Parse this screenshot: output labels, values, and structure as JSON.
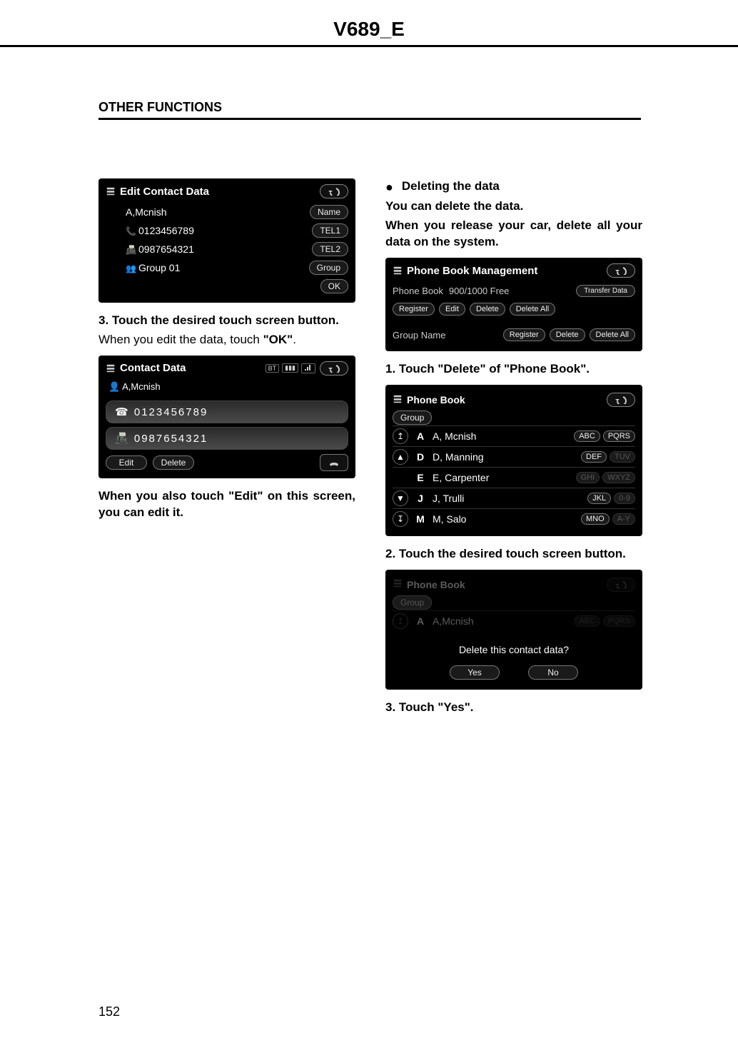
{
  "header": {
    "title": "V689_E"
  },
  "section": {
    "title": "OTHER FUNCTIONS"
  },
  "page_number": "152",
  "left": {
    "screen1": {
      "title": "Edit Contact Data",
      "rows": [
        {
          "icon": "",
          "text": "A,Mcnish",
          "btn": "Name"
        },
        {
          "icon": "📞",
          "text": "0123456789",
          "btn": "TEL1"
        },
        {
          "icon": "📠",
          "text": "0987654321",
          "btn": "TEL2"
        },
        {
          "icon": "👥",
          "text": "Group 01",
          "btn": "Group"
        }
      ],
      "ok": "OK"
    },
    "step3": "3.  Touch the desired touch screen button.",
    "step3_sub_pre": "When you edit the data, touch ",
    "step3_sub_ok": "\"OK\"",
    "step3_sub_post": ".",
    "screen2": {
      "title": "Contact Data",
      "ind_bt": "BT",
      "ind_batt": "▮▮▮",
      "person": "A,Mcnish",
      "rows": [
        {
          "icon": "☎",
          "text": "0123456789"
        },
        {
          "icon": "📠",
          "text": "0987654321"
        }
      ],
      "edit": "Edit",
      "delete": "Delete"
    },
    "note": "When you also touch \"Edit\" on this screen, you can edit it."
  },
  "right": {
    "bullet": "Deleting the data",
    "p1": "You can delete the data.",
    "p2": "When you release your car, delete all your data on the system.",
    "screen3": {
      "title": "Phone Book Management",
      "pb_label": "Phone Book",
      "free": "900/1000 Free",
      "transfer": "Transfer Data",
      "register": "Register",
      "edit": "Edit",
      "delete": "Delete",
      "delete_all": "Delete All",
      "grp_label": "Group Name",
      "grp_register": "Register",
      "grp_delete": "Delete",
      "grp_delete_all": "Delete All"
    },
    "step1": "1.  Touch \"Delete\" of \"Phone Book\".",
    "screen4": {
      "title": "Phone Book",
      "group": "Group",
      "rows": [
        {
          "arrow": "↥",
          "letter": "A",
          "name": "A, Mcnish",
          "g1": "ABC",
          "g2": "PQRS",
          "dim": false
        },
        {
          "arrow": "▲",
          "letter": "D",
          "name": "D, Manning",
          "g1": "DEF",
          "g2": "TUV",
          "dim_g2": true
        },
        {
          "arrow": "",
          "letter": "E",
          "name": "E, Carpenter",
          "g1": "GHI",
          "g2": "WXYZ",
          "dim": true
        },
        {
          "arrow": "▼",
          "letter": "J",
          "name": "J, Trulli",
          "g1": "JKL",
          "g2": "0-9",
          "dim_g2": true
        },
        {
          "arrow": "↧",
          "letter": "M",
          "name": "M, Salo",
          "g1": "MNO",
          "g2": "A-Y",
          "dim_g2": true
        }
      ]
    },
    "step2": "2.  Touch the desired touch screen button.",
    "screen5": {
      "title": "Phone Book",
      "group": "Group",
      "row_letter": "A",
      "row_name": "A,Mcnish",
      "row_g1": "ABC",
      "row_g2": "PQRS",
      "confirm": "Delete this contact data?",
      "yes": "Yes",
      "no": "No"
    },
    "step3": "3.  Touch \"Yes\"."
  }
}
